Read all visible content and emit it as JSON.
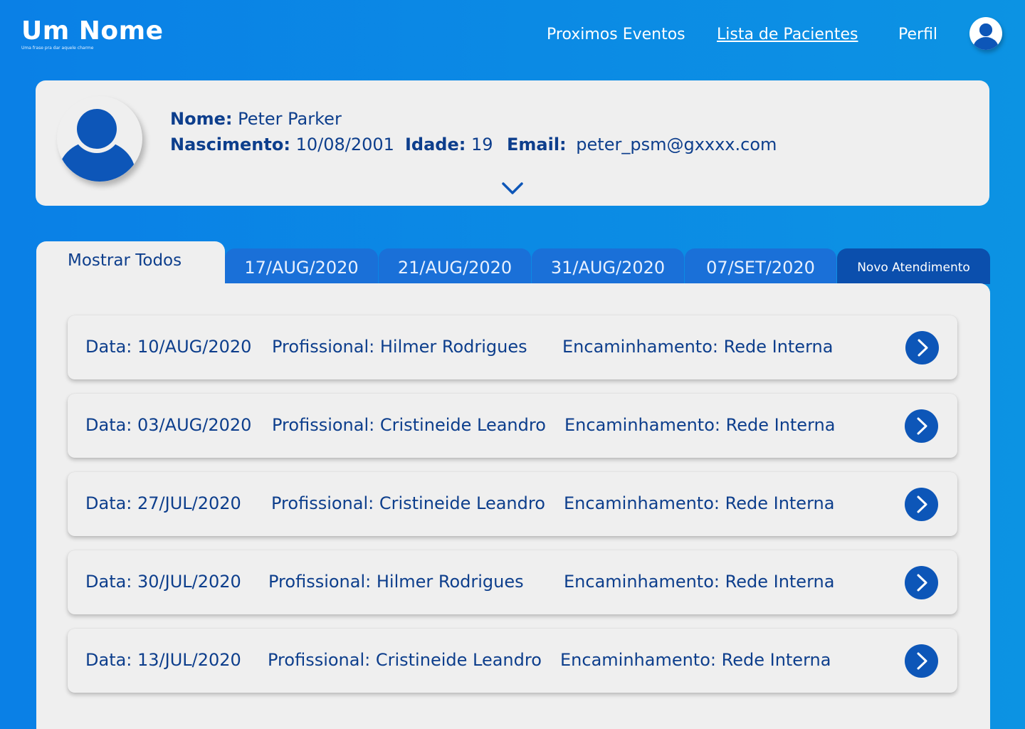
{
  "header": {
    "logo_title": "Um Nome",
    "logo_subtitle": "Uma frase pra dar aquele charme",
    "nav": [
      {
        "label": "Proximos Eventos"
      },
      {
        "label": "Lista de Pacientes",
        "active": true
      },
      {
        "label": "Perfil"
      }
    ],
    "profile_icon": "user-avatar-icon"
  },
  "patient": {
    "avatar_icon": "user-avatar-icon",
    "name_label": "Nome:",
    "name": "Peter Parker",
    "birth_label": "Nascimento:",
    "birth": "10/08/2001",
    "age_label": "Idade:",
    "age": "19",
    "email_label": "Email:",
    "email": "peter_psm@gxxxx.com",
    "expand_icon": "chevron-down-icon"
  },
  "tabs": {
    "active": "Mostrar Todos",
    "dates": [
      "17/AUG/2020",
      "21/AUG/2020",
      "31/AUG/2020",
      "07/SET/2020"
    ],
    "new_button": "Novo Atendimento"
  },
  "records": [
    {
      "date": "Data: 10/AUG/2020",
      "professional": "Profissional: Hilmer Rodrigues",
      "referral": "Encaminhamento: Rede Interna"
    },
    {
      "date": "Data: 03/AUG/2020",
      "professional": "Profissional: Cristineide Leandro",
      "referral": "Encaminhamento: Rede Interna"
    },
    {
      "date": "Data: 27/JUL/2020",
      "professional": "Profissional: Cristineide Leandro",
      "referral": "Encaminhamento: Rede Interna"
    },
    {
      "date": "Data: 30/JUL/2020",
      "professional": "Profissional: Hilmer Rodrigues",
      "referral": "Encaminhamento: Rede Interna"
    },
    {
      "date": "Data: 13/JUL/2020",
      "professional": "Profissional: Cristineide Leandro",
      "referral": "Encaminhamento: Rede Interna"
    }
  ],
  "colors": {
    "background": "#0a80e6",
    "card": "#efefef",
    "text_dark": "#0d3e8c",
    "tab": "#1a70d8",
    "new_button": "#0b4fad",
    "action_button": "#0d56b8"
  }
}
